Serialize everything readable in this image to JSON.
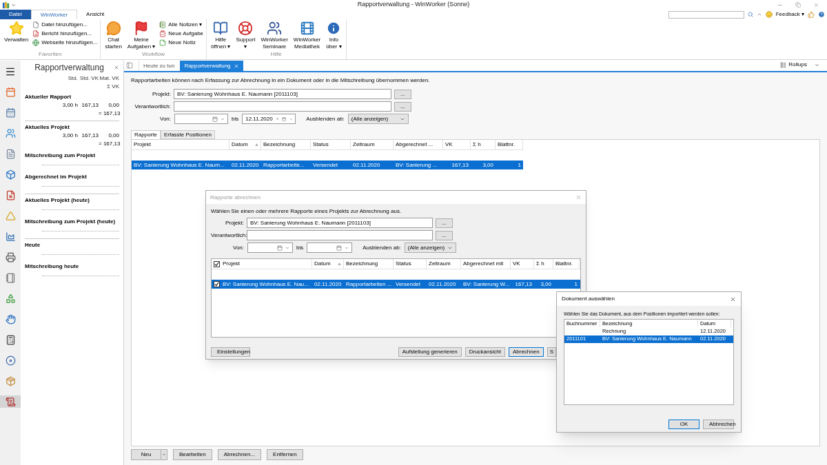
{
  "window": {
    "title": "Rapportverwaltung - WinWorker (Sonne)"
  },
  "ribbon_tabs": [
    {
      "label": "Datei",
      "kind": "file",
      "selected": false
    },
    {
      "label": "WinWorker",
      "kind": "tab",
      "selected": true
    },
    {
      "label": "Ansicht",
      "kind": "tab",
      "selected": false
    }
  ],
  "top_right": {
    "feedback": "Feedback ▾"
  },
  "ribbon_groups": [
    {
      "title": "Favoriten",
      "items": [
        {
          "kind": "large",
          "lines": [
            "Verwalten"
          ]
        },
        {
          "kind": "stack",
          "items": [
            "Datei hinzufügen...",
            "Bericht hinzufügen...",
            "Webseite hinzufügen..."
          ]
        }
      ]
    },
    {
      "title": "Workflow",
      "items": [
        {
          "kind": "large",
          "lines": [
            "Chat",
            "starten"
          ]
        },
        {
          "kind": "large",
          "lines": [
            "Meine",
            "Aufgaben ▾"
          ]
        },
        {
          "kind": "stack",
          "items": [
            "Alle Notizen ▾",
            "Neue Aufgabe",
            "Neue Notiz"
          ]
        }
      ]
    },
    {
      "title": "Hilfe",
      "items": [
        {
          "kind": "large",
          "lines": [
            "Hilfe",
            "öffnen ▾"
          ]
        },
        {
          "kind": "large",
          "lines": [
            "Support",
            "▾"
          ]
        },
        {
          "kind": "large",
          "lines": [
            "WinWorker",
            "Seminare"
          ]
        },
        {
          "kind": "large",
          "lines": [
            "WinWorker",
            "Mediathek"
          ]
        },
        {
          "kind": "large",
          "lines": [
            "Info",
            "über ▾"
          ]
        }
      ]
    }
  ],
  "nav_items": [
    {
      "selected": false
    },
    {
      "selected": false
    },
    {
      "selected": false
    },
    {
      "selected": false
    },
    {
      "selected": false
    },
    {
      "selected": false
    },
    {
      "selected": false
    },
    {
      "selected": false
    },
    {
      "selected": false
    },
    {
      "selected": false
    },
    {
      "selected": false
    },
    {
      "selected": false
    },
    {
      "selected": false
    },
    {
      "selected": false
    },
    {
      "selected": false
    },
    {
      "selected": true
    }
  ],
  "side_panel": {
    "title": "Rapportverwaltung",
    "columns": [
      "Std.",
      "Std. VK",
      "Mat. VK"
    ],
    "sum_column": "Σ VK",
    "sections": [
      {
        "kind": "section",
        "title": "Aktueller Rapport",
        "values": [
          "3,00 h",
          "167,13",
          "0,00"
        ],
        "sum": "= 167,13"
      },
      {
        "kind": "divider"
      },
      {
        "kind": "section",
        "title": "Aktuelles Projekt",
        "values": [
          "3,00 h",
          "167,13",
          "0,00"
        ],
        "sum": "= 167,13"
      },
      {
        "kind": "section",
        "title": "Mitschreibung zum Projekt"
      },
      {
        "kind": "section",
        "title": "Abgerechnet im Projekt"
      },
      {
        "kind": "divider"
      },
      {
        "kind": "section",
        "title": "Aktuelles Projekt (heute)"
      },
      {
        "kind": "section",
        "title": "Mitschreibung zum Projekt (heute)"
      },
      {
        "kind": "divider"
      },
      {
        "kind": "section",
        "title": "Heute"
      },
      {
        "kind": "section",
        "title": "Mitschreibung heute"
      }
    ]
  },
  "doc_tabs": [
    {
      "label": "Heute zu tun",
      "selected": false
    },
    {
      "label": "Rapportverwaltung",
      "selected": true
    }
  ],
  "rollups": "Rollups",
  "main": {
    "description": "Rapportarbeiten können nach Erfassung zur Abrechnung in ein Dokument oder in die Mitschreibung übernommen werden.",
    "form": {
      "project_label": "Projekt:",
      "project_value": "BV: Sanierung Wohnhaus E. Naumann [2011103]",
      "responsible_label": "Verantwortlich:",
      "browse": "...",
      "from_label": "Von:",
      "to_label": "bis",
      "to_value": "12.11.2020",
      "hide_label": "Ausblenden ab:",
      "hide_value": "(Alle anzeigen)"
    },
    "tabs": [
      {
        "label": "Rapporte",
        "selected": true
      },
      {
        "label": "Erfasste Positionen",
        "selected": false
      }
    ],
    "table": {
      "columns": [
        {
          "label": "Projekt",
          "sorted": false
        },
        {
          "label": "Datum",
          "sorted": true
        },
        {
          "label": "Bezeichnung",
          "sorted": false
        },
        {
          "label": "Status",
          "sorted": false
        },
        {
          "label": "Zeitraum",
          "sorted": false
        },
        {
          "label": "Abgerechnet ...",
          "sorted": false
        },
        {
          "label": "VK",
          "sorted": false
        },
        {
          "label": "Σ h",
          "sorted": false
        },
        {
          "label": "Blattnr.",
          "sorted": false
        }
      ],
      "rows": [
        {
          "cells": [
            "BV: Sanierung Wohnhaus E. Naum...",
            "02.11.2020",
            "Rapportarbeite...",
            "Versendet",
            "02.11.2020",
            "BV: Sanierung ...",
            "167,13",
            "3,00",
            "1"
          ],
          "selected": true
        }
      ]
    },
    "buttons": [
      {
        "label": "Neu",
        "kind": "split"
      },
      {
        "label": "Bearbeiten",
        "kind": "plain"
      },
      {
        "label": "Abrechnen...",
        "kind": "plain"
      },
      {
        "label": "Entfernen",
        "kind": "plain"
      }
    ]
  },
  "dialog_rapporte": {
    "title": "Rapporte abrechnen",
    "description": "Wählen Sie einen oder mehrere Rapporte eines Projekts zur Abrechnung aus.",
    "form": {
      "project_label": "Projekt:",
      "project_value": "BV: Sanierung Wohnhaus E. Naumann [2011103]",
      "responsible_label": "Verantwortlich:",
      "browse": "...",
      "from_label": "Von:",
      "to_label": "bis",
      "hide_label": "Ausblenden ab:",
      "hide_value": "(Alle anzeigen)"
    },
    "table": {
      "all_checked": true,
      "columns": [
        {
          "label": "Projekt",
          "sorted": false
        },
        {
          "label": "Datum",
          "sorted": true
        },
        {
          "label": "Bezeichnung",
          "sorted": false
        },
        {
          "label": "Status",
          "sorted": false
        },
        {
          "label": "Zeitraum",
          "sorted": false
        },
        {
          "label": "Abgerechnet mit",
          "sorted": false
        },
        {
          "label": "VK",
          "sorted": false
        },
        {
          "label": "Σ h",
          "sorted": false
        },
        {
          "label": "Blattnr.",
          "sorted": false
        }
      ],
      "rows": [
        {
          "cells": [
            "BV: Sanierung Wohnhaus E. Nau...",
            "02.11.2020",
            "Rapportarbeiten ...",
            "Versendet",
            "02.11.2020",
            "BV: Sanierung W...",
            "167,13",
            "3,00",
            "1"
          ],
          "selected": true,
          "checked": true
        }
      ]
    },
    "buttons": [
      {
        "label": "Einstellungen",
        "default": false
      },
      {
        "label": "Aufstellung generieren",
        "default": false
      },
      {
        "label": "Druckansicht",
        "default": false
      },
      {
        "label": "Abrechnen",
        "default": true
      },
      {
        "label": "S",
        "default": false
      }
    ]
  },
  "dialog_dokument": {
    "title": "Dokument auswählen",
    "description": "Wählen Sie das Dokument, aus dem Positionen importiert werden sollen:",
    "columns": [
      "Buchnummer",
      "Bezeichnung",
      "Datum"
    ],
    "rows": [
      {
        "cells": [
          "",
          "Rechnung",
          "12.11.2020"
        ],
        "selected": false
      },
      {
        "cells": [
          "2011101",
          "BV: Sanierung Wohnhaus E. Naumann",
          "02.11.2020"
        ],
        "selected": true
      }
    ],
    "buttons": [
      {
        "label": "OK",
        "default": true
      },
      {
        "label": "Abbrechen",
        "default": false
      }
    ]
  }
}
